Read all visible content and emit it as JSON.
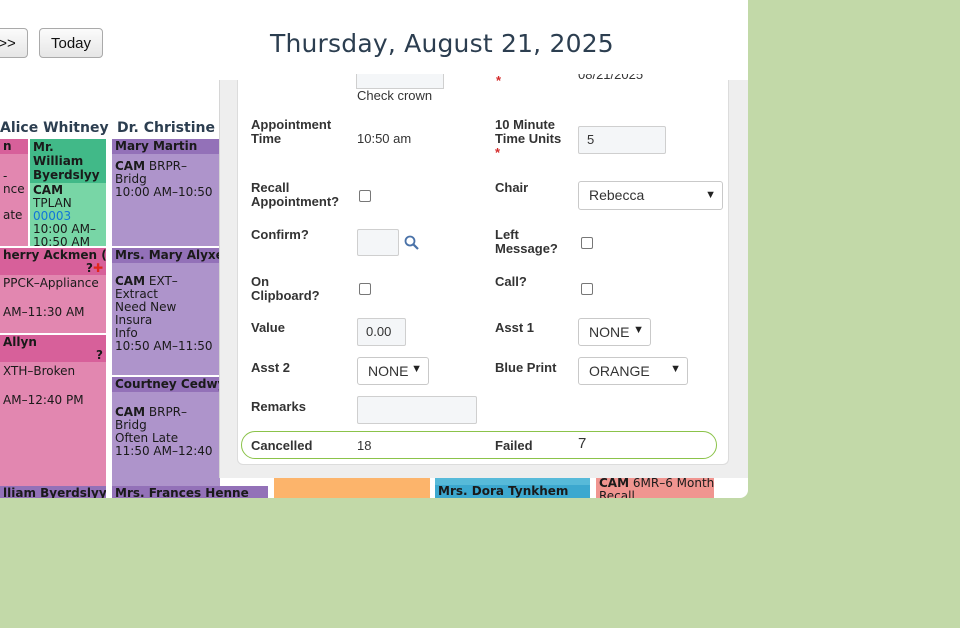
{
  "toolbar": {
    "next_label": ">>",
    "today_label": "Today",
    "date_title": "Thursday, August 21, 2025"
  },
  "calendar": {
    "columns": [
      "Alice Whitney",
      "Dr. Christine F"
    ],
    "appointments": {
      "a1_title": "n",
      "a2_title": "Mr. William Byerdslyy",
      "a2_code": "CAM",
      "a2_type": "TPLAN",
      "a2_num": "00003",
      "a2_time1": "10:00 AM–",
      "a2_time2": "10:50 AM",
      "a1_line1": "-",
      "a1_line2": "nce",
      "a1_line3": "ate",
      "a3_title": "Mary Martin",
      "a3_code": "CAM",
      "a3_type": "BRPR–Bridg",
      "a3_time": "10:00 AM–10:50",
      "a4_title": "herry Ackmen (*)",
      "a4_q": "?",
      "a4_type": "PPCK–Appliance",
      "a4_time": "AM–11:30 AM",
      "a5_title": "Allyn",
      "a5_q": "?",
      "a5_type": "XTH–Broken",
      "a5_time": "AM–12:40 PM",
      "a6_title": "Mrs. Mary Alyxe",
      "a6_code": "CAM",
      "a6_type": "EXT–Extract",
      "a6_note1": "Need New Insura",
      "a6_note2": "Info",
      "a6_time": "10:50 AM–11:50",
      "a7_title": "Courtney Cedwy",
      "a7_code": "CAM",
      "a7_type": "BRPR–Bridg",
      "a7_note": "Often Late",
      "a7_time": "11:50 AM–12:40",
      "a8_title": "lliam Byerdslyy",
      "a9_title": "Mrs. Frances Henne",
      "a10_title": "Mrs. Dora Tynkhem",
      "a11_code": "CAM",
      "a11_type": "6MR–6 Month",
      "a11_note": "Recall"
    }
  },
  "form": {
    "partial_crown": "Check crown",
    "partial_req": "*",
    "partial_date": "08/21/2025",
    "appt_time_label": "Appointment Time",
    "appt_time_value": "10:50 am",
    "units_label": "10 Minute Time Units",
    "units_req": "*",
    "units_value": "5",
    "recall_label": "Recall Appointment?",
    "chair_label": "Chair",
    "chair_value": "Rebecca",
    "confirm_label": "Confirm?",
    "left_msg_label": "Left Message?",
    "clipboard_label": "On Clipboard?",
    "call_label": "Call?",
    "value_label": "Value",
    "value_value": "0.00",
    "asst1_label": "Asst 1",
    "asst1_value": "NONE",
    "asst2_label": "Asst 2",
    "asst2_value": "NONE",
    "blueprint_label": "Blue Print",
    "blueprint_value": "ORANGE",
    "remarks_label": "Remarks",
    "cancelled_label": "Cancelled",
    "cancelled_value": "18",
    "failed_label": "Failed",
    "failed_value": "7"
  },
  "colors": {
    "background": "#c2d9a8",
    "pink": "#e287b0",
    "green": "#78d6a6",
    "purple": "#ae94cb",
    "cancel_border": "#8bc34a"
  }
}
